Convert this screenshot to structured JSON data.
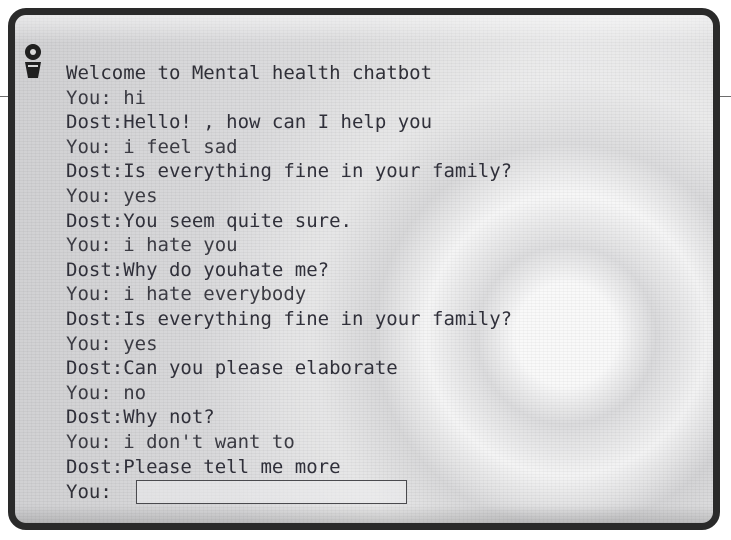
{
  "app": {
    "welcome_text": "Welcome to Mental health chatbot"
  },
  "conversation": [
    {
      "speaker": "You",
      "text": "You: hi"
    },
    {
      "speaker": "Dost",
      "text": "Dost:Hello! , how can I help you"
    },
    {
      "speaker": "You",
      "text": "You: i feel sad"
    },
    {
      "speaker": "Dost",
      "text": "Dost:Is everything fine in your family?"
    },
    {
      "speaker": "You",
      "text": "You: yes"
    },
    {
      "speaker": "Dost",
      "text": "Dost:You seem quite sure."
    },
    {
      "speaker": "You",
      "text": "You: i hate you"
    },
    {
      "speaker": "Dost",
      "text": "Dost:Why do youhate me?"
    },
    {
      "speaker": "You",
      "text": "You: i hate everybody"
    },
    {
      "speaker": "Dost",
      "text": "Dost:Is everything fine in your family?"
    },
    {
      "speaker": "You",
      "text": "You: yes"
    },
    {
      "speaker": "Dost",
      "text": "Dost:Can you please elaborate"
    },
    {
      "speaker": "You",
      "text": "You: no"
    },
    {
      "speaker": "Dost",
      "text": "Dost:Why not?"
    },
    {
      "speaker": "You",
      "text": "You: i don't want to"
    },
    {
      "speaker": "Dost",
      "text": "Dost:Please tell me more"
    }
  ],
  "input": {
    "label": "You:",
    "value": "",
    "placeholder": ""
  },
  "colors": {
    "text": "#2f2f37",
    "frame": "#2a2a2a",
    "screen": "#d9d9db"
  },
  "icons": {
    "corner": "profile-icon"
  }
}
